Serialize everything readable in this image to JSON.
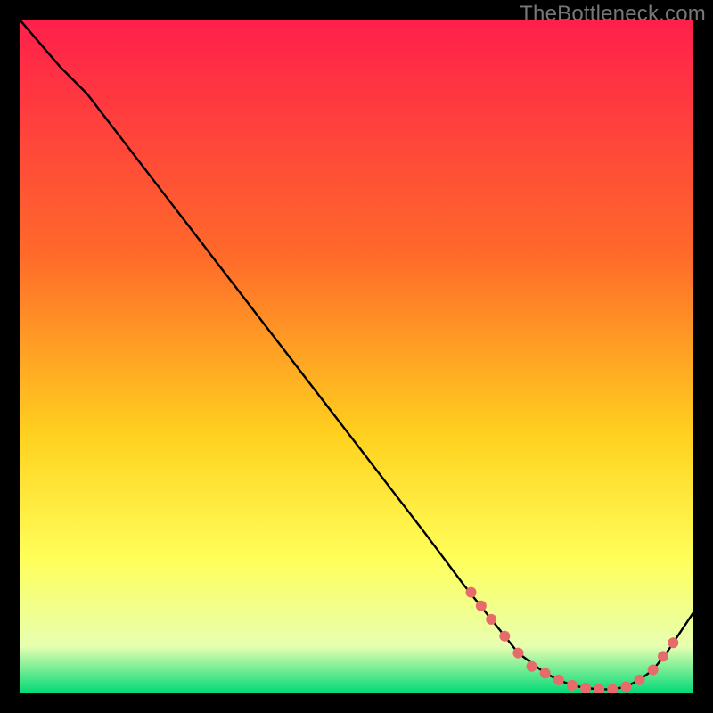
{
  "watermark": "TheBottleneck.com",
  "colors": {
    "gradient_top": "#ff1f4b",
    "gradient_mid1": "#ff6a2a",
    "gradient_mid2": "#ffd21f",
    "gradient_mid3": "#ffff5a",
    "gradient_mid4": "#e7ffb0",
    "gradient_bottom": "#00d977",
    "line": "#000000",
    "marker": "#e86b6b",
    "background": "#000000"
  },
  "chart_data": {
    "type": "line",
    "title": "",
    "xlabel": "",
    "ylabel": "",
    "xlim": [
      0,
      100
    ],
    "ylim": [
      0,
      100
    ],
    "grid": false,
    "legend": false,
    "series": [
      {
        "name": "curve",
        "x": [
          0,
          6,
          10,
          20,
          30,
          40,
          50,
          60,
          66,
          70,
          74,
          78,
          80,
          82,
          84,
          86,
          88,
          90,
          92,
          94,
          96,
          98,
          100
        ],
        "y": [
          100,
          93,
          89,
          76,
          63,
          50,
          37,
          24,
          16,
          11,
          6,
          3,
          2,
          1.2,
          0.8,
          0.6,
          0.6,
          1.0,
          2.0,
          3.5,
          6,
          9,
          12
        ]
      }
    ],
    "markers": {
      "name": "highlight-dots",
      "x": [
        67,
        68.5,
        70,
        72,
        74,
        76,
        78,
        80,
        82,
        84,
        86,
        88,
        90,
        92,
        94,
        95.5,
        97
      ],
      "y": [
        15,
        13,
        11,
        8.5,
        6,
        4,
        3,
        2,
        1.2,
        0.8,
        0.6,
        0.6,
        1.0,
        2.0,
        3.5,
        5.5,
        7.5
      ]
    }
  }
}
